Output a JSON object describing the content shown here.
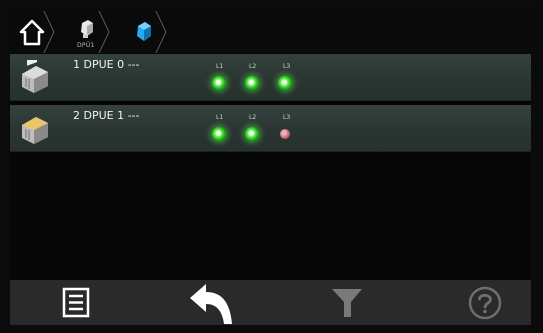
{
  "breadcrumb": {
    "items": [
      {
        "icon": "home-icon"
      },
      {
        "icon": "dpu-device-icon",
        "label": "DPÜ1"
      },
      {
        "icon": "dpu-device-selected-icon"
      }
    ]
  },
  "devices": [
    {
      "name": "1 DPUE 0 ---",
      "icon": "dpue-module-icon",
      "leds": [
        {
          "label": "L1",
          "state": "on"
        },
        {
          "label": "L2",
          "state": "on"
        },
        {
          "label": "L3",
          "state": "on"
        }
      ]
    },
    {
      "name": "2 DPUE 1 ---",
      "icon": "dpue-module-warning-icon",
      "leds": [
        {
          "label": "L1",
          "state": "on"
        },
        {
          "label": "L2",
          "state": "on"
        },
        {
          "label": "L3",
          "state": "off"
        }
      ]
    }
  ],
  "toolbar": {
    "buttons": [
      {
        "icon": "menu-list-icon",
        "enabled": true
      },
      {
        "icon": "back-arrow-icon",
        "enabled": true
      },
      {
        "icon": "filter-icon",
        "enabled": false
      },
      {
        "icon": "help-icon",
        "enabled": false
      }
    ]
  },
  "colors": {
    "row_bg": "#2f3b37",
    "led_on": "#3ee032",
    "led_off": "#c96b78",
    "selected_crumb": "#1e9be8"
  }
}
